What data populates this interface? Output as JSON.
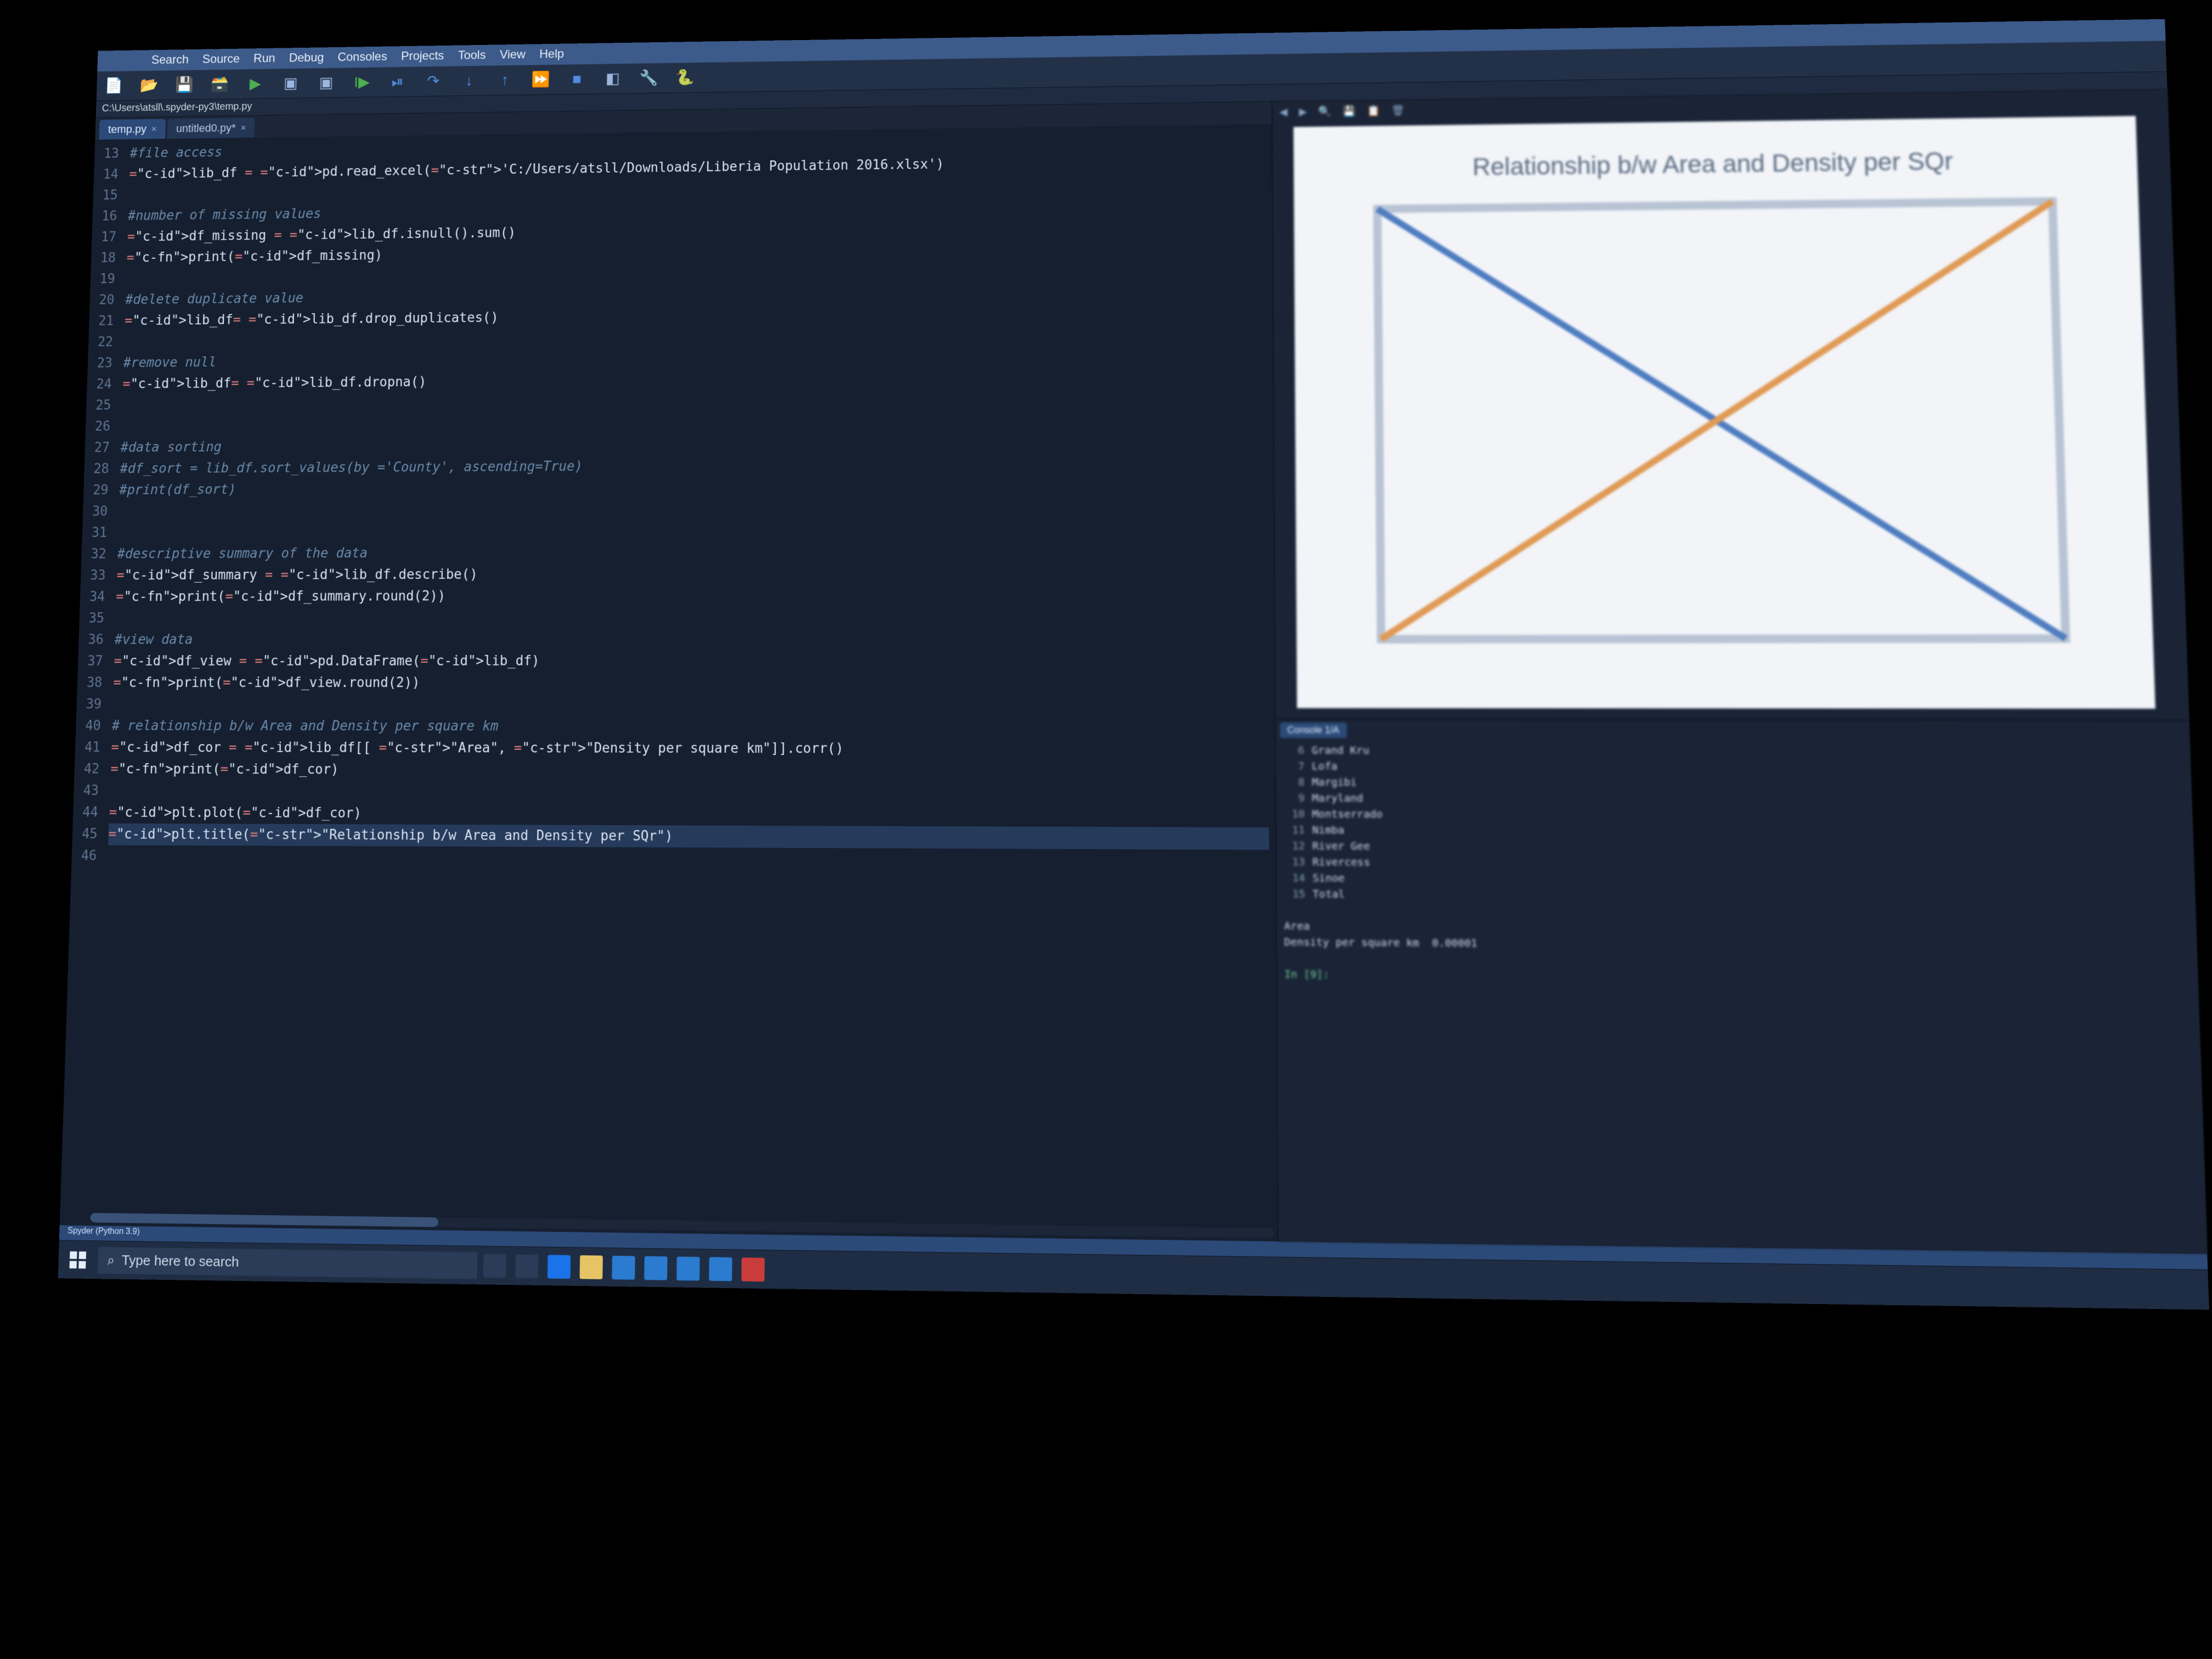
{
  "menu": [
    "Search",
    "Source",
    "Run",
    "Debug",
    "Consoles",
    "Projects",
    "Tools",
    "View",
    "Help"
  ],
  "path": "C:\\Users\\atsll\\.spyder-py3\\temp.py",
  "tabs": [
    {
      "label": "temp.py",
      "dirty": false,
      "active": true
    },
    {
      "label": "untitled0.py*",
      "dirty": true,
      "active": false
    }
  ],
  "code": {
    "first_line": 13,
    "highlight": 45,
    "lines": [
      {
        "t": "cmt",
        "s": "#file access"
      },
      {
        "t": "code",
        "s": "lib_df = pd.read_excel('C:/Users/atsll/Downloads/Liberia Population 2016.xlsx')"
      },
      {
        "t": "blank",
        "s": ""
      },
      {
        "t": "cmt",
        "s": "#number of missing values"
      },
      {
        "t": "code",
        "s": "df_missing = lib_df.isnull().sum()"
      },
      {
        "t": "code",
        "s": "print(df_missing)"
      },
      {
        "t": "blank",
        "s": ""
      },
      {
        "t": "cmt",
        "s": "#delete duplicate value"
      },
      {
        "t": "code",
        "s": "lib_df= lib_df.drop_duplicates()"
      },
      {
        "t": "blank",
        "s": ""
      },
      {
        "t": "cmt",
        "s": "#remove null"
      },
      {
        "t": "code",
        "s": "lib_df= lib_df.dropna()"
      },
      {
        "t": "blank",
        "s": ""
      },
      {
        "t": "blank",
        "s": ""
      },
      {
        "t": "cmt",
        "s": "#data sorting"
      },
      {
        "t": "cmt",
        "s": "#df_sort = lib_df.sort_values(by ='County', ascending=True)"
      },
      {
        "t": "cmt",
        "s": "#print(df_sort)"
      },
      {
        "t": "blank",
        "s": ""
      },
      {
        "t": "blank",
        "s": ""
      },
      {
        "t": "cmt",
        "s": "#descriptive summary of the data"
      },
      {
        "t": "code",
        "s": "df_summary = lib_df.describe()"
      },
      {
        "t": "code",
        "s": "print(df_summary.round(2))"
      },
      {
        "t": "blank",
        "s": ""
      },
      {
        "t": "cmt",
        "s": "#view data"
      },
      {
        "t": "code",
        "s": "df_view = pd.DataFrame(lib_df)"
      },
      {
        "t": "code",
        "s": "print(df_view.round(2))"
      },
      {
        "t": "blank",
        "s": ""
      },
      {
        "t": "cmt",
        "s": "# relationship b/w Area and Density per square km"
      },
      {
        "t": "code",
        "s": "df_cor = lib_df[[ \"Area\", \"Density per square km\"]].corr()"
      },
      {
        "t": "code",
        "s": "print(df_cor)"
      },
      {
        "t": "blank",
        "s": ""
      },
      {
        "t": "code",
        "s": "plt.plot(df_cor)"
      },
      {
        "t": "code",
        "s": "plt.title(\"Relationship b/w Area and Density per SQr\")"
      },
      {
        "t": "blank",
        "s": ""
      }
    ]
  },
  "plot": {
    "title": "Relationship b/w Area and Density per SQr"
  },
  "console": {
    "tab": "Console 1/A",
    "rows": [
      {
        "n": "6",
        "label": "Grand Kru"
      },
      {
        "n": "7",
        "label": "Lofa"
      },
      {
        "n": "8",
        "label": "Margibi"
      },
      {
        "n": "9",
        "label": "Maryland"
      },
      {
        "n": "10",
        "label": "Montserrado"
      },
      {
        "n": "11",
        "label": "Nimba"
      },
      {
        "n": "12",
        "label": "River Gee"
      },
      {
        "n": "13",
        "label": "Rivercess"
      },
      {
        "n": "14",
        "label": "Sinoe"
      },
      {
        "n": "15",
        "label": "Total"
      }
    ],
    "footer1": "Area",
    "footer2": "Density per square km  0.00001",
    "prompt": "In [9]:"
  },
  "status": "Spyder (Python 3.9)",
  "search_placeholder": "Type here to search",
  "task_icons": [
    "cortana",
    "task-view",
    "edge",
    "explorer",
    "store",
    "mail",
    "photos",
    "movies",
    "spyder"
  ]
}
